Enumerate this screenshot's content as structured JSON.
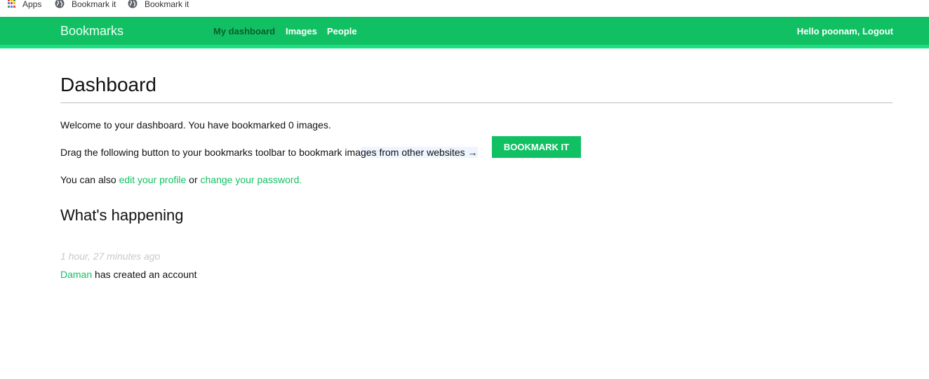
{
  "browser_bookmarks": {
    "apps_label": "Apps",
    "items": [
      {
        "label": "Bookmark it"
      },
      {
        "label": "Bookmark it"
      }
    ],
    "apps_colors": [
      "#ea4335",
      "#fbbc05",
      "#34a853",
      "#4285f4",
      "#ea4335",
      "#fbbc05",
      "#34a853",
      "#4285f4",
      "#ea4335"
    ]
  },
  "nav": {
    "brand": "Bookmarks",
    "links": [
      {
        "label": "My dashboard",
        "active": true
      },
      {
        "label": "Images"
      },
      {
        "label": "People"
      }
    ],
    "greeting": "Hello poonam,",
    "logout": "Logout",
    "accent": "#12c064",
    "stripe": "#1fde82"
  },
  "dashboard": {
    "title": "Dashboard",
    "welcome": "Welcome to your dashboard. You have bookmarked 0 images.",
    "drag_text_1": "Drag the following button to your bookmarks toolbar to bookmark ima",
    "drag_text_2": "ges from other websites →",
    "bookmark_button": "BOOKMARK IT",
    "also_prefix": "You can also",
    "edit_profile": "edit your profile",
    "or_text": "or",
    "change_password": "change your password",
    "period": "."
  },
  "activity": {
    "title": "What's happening",
    "items": [
      {
        "time": "1 hour, 27 minutes ago",
        "user": "Daman",
        "action": "has created an account"
      }
    ]
  }
}
